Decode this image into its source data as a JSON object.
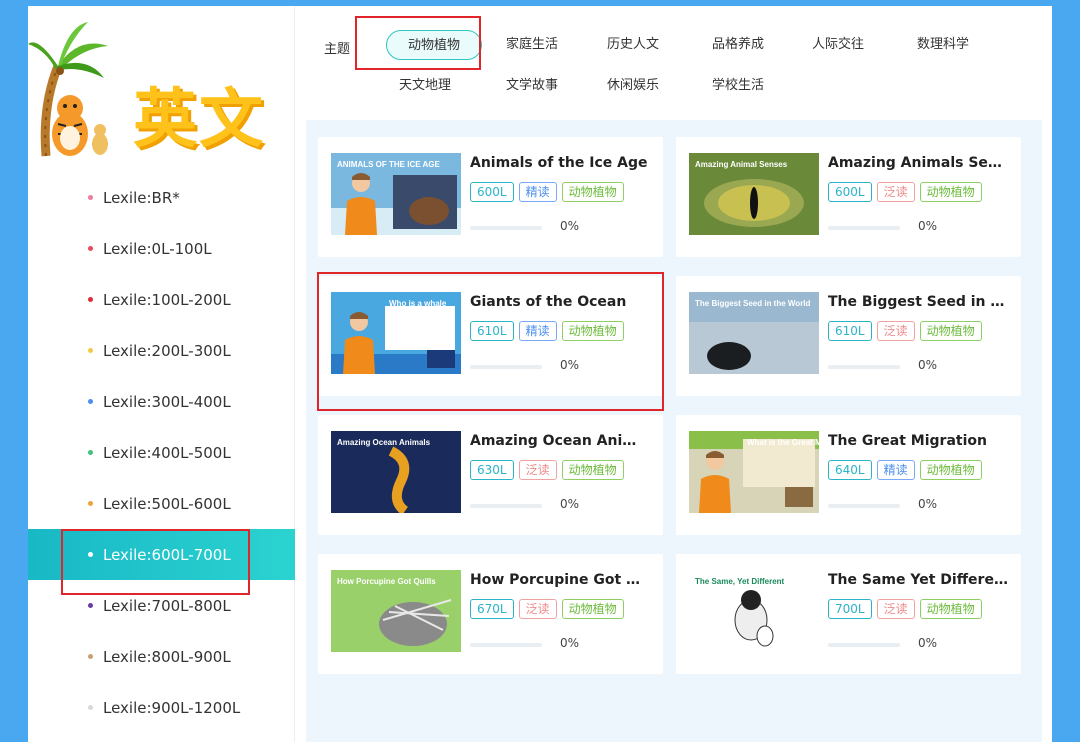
{
  "sidebar": {
    "logo_title": "英文",
    "levels": [
      {
        "label": "Lexile:BR*",
        "color": "#f07a9a"
      },
      {
        "label": "Lexile:0L-100L",
        "color": "#e84a5f"
      },
      {
        "label": "Lexile:100L-200L",
        "color": "#e02a3a"
      },
      {
        "label": "Lexile:200L-300L",
        "color": "#f5c842"
      },
      {
        "label": "Lexile:300L-400L",
        "color": "#4a8ef0"
      },
      {
        "label": "Lexile:400L-500L",
        "color": "#3cc47c"
      },
      {
        "label": "Lexile:500L-600L",
        "color": "#f0a23a"
      },
      {
        "label": "Lexile:600L-700L",
        "color": "#ffffff"
      },
      {
        "label": "Lexile:700L-800L",
        "color": "#6a3ca8"
      },
      {
        "label": "Lexile:800L-900L",
        "color": "#c8a070"
      },
      {
        "label": "Lexile:900L-1200L",
        "color": "#d8d8d8"
      }
    ],
    "active_index": 7
  },
  "topics": {
    "label": "主题",
    "items": [
      "动物植物",
      "家庭生活",
      "历史人文",
      "品格养成",
      "人际交往",
      "数理科学",
      "天文地理",
      "文学故事",
      "休闲娱乐",
      "学校生活"
    ],
    "active": "动物植物"
  },
  "cards": [
    {
      "title": "Animals of the Ice Age",
      "lexile": "600L",
      "mode": "精读",
      "category": "动物植物",
      "progress": 0,
      "progress_text": "0%",
      "thumb": "ice-age"
    },
    {
      "title": "Amazing Animals Senses",
      "lexile": "600L",
      "mode": "泛读",
      "category": "动物植物",
      "progress": 0,
      "progress_text": "0%",
      "thumb": "animal-senses"
    },
    {
      "title": "Giants of the Ocean",
      "lexile": "610L",
      "mode": "精读",
      "category": "动物植物",
      "progress": 0,
      "progress_text": "0%",
      "thumb": "ocean-giants"
    },
    {
      "title": "The Biggest Seed in the World",
      "lexile": "610L",
      "mode": "泛读",
      "category": "动物植物",
      "progress": 0,
      "progress_text": "0%",
      "thumb": "biggest-seed"
    },
    {
      "title": "Amazing Ocean Animals",
      "lexile": "630L",
      "mode": "泛读",
      "category": "动物植物",
      "progress": 0,
      "progress_text": "0%",
      "thumb": "ocean-animals"
    },
    {
      "title": "The Great Migration",
      "lexile": "640L",
      "mode": "精读",
      "category": "动物植物",
      "progress": 0,
      "progress_text": "0%",
      "thumb": "great-migration"
    },
    {
      "title": "How Porcupine Got Quills",
      "lexile": "670L",
      "mode": "泛读",
      "category": "动物植物",
      "progress": 0,
      "progress_text": "0%",
      "thumb": "porcupine"
    },
    {
      "title": "The Same Yet Different",
      "lexile": "700L",
      "mode": "泛读",
      "category": "动物植物",
      "progress": 0,
      "progress_text": "0%",
      "thumb": "same-different"
    }
  ],
  "thumb_captions": {
    "ice-age": "ANIMALS OF THE ICE AGE",
    "animal-senses": "Amazing Animal Senses",
    "ocean-giants": "Who is a whale",
    "biggest-seed": "The Biggest Seed in the World",
    "ocean-animals": "Amazing Ocean Animals",
    "great-migration": "What is the Great Migration",
    "porcupine": "How Porcupine Got Quills",
    "same-different": "The Same, Yet Different"
  }
}
